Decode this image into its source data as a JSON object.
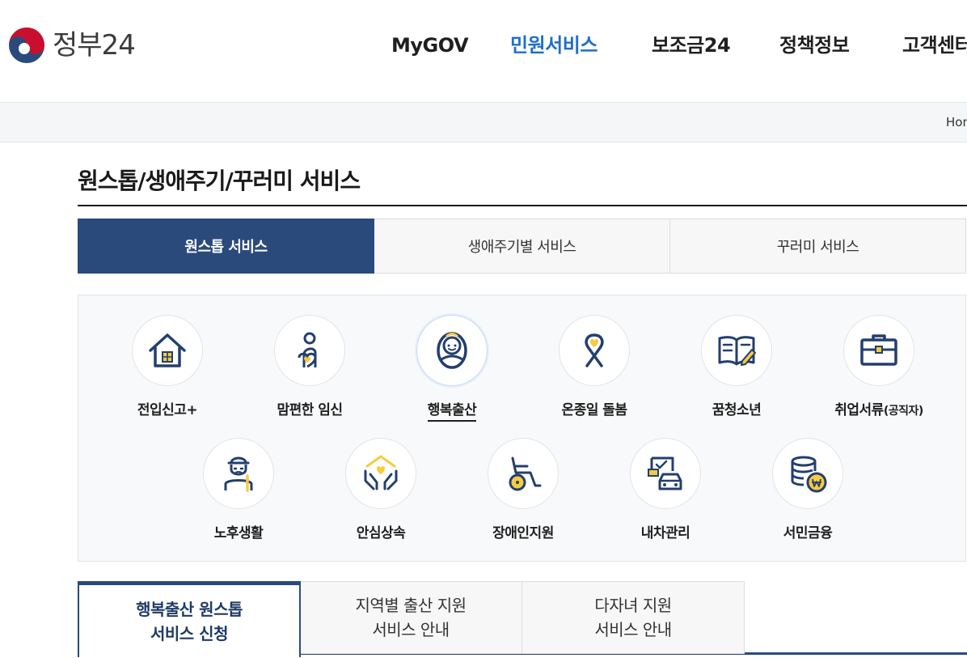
{
  "header": {
    "logo_text": "정부24",
    "nav": [
      {
        "label": "MyGOV",
        "active": false
      },
      {
        "label": "민원서비스",
        "active": true
      },
      {
        "label": "보조금24",
        "active": false
      },
      {
        "label": "정책정보",
        "active": false
      },
      {
        "label": "고객센터",
        "active": false
      }
    ]
  },
  "breadcrumb": {
    "home": "Home"
  },
  "page": {
    "title": "원스톱/생애주기/꾸러미 서비스"
  },
  "tabs": [
    {
      "label": "원스톱 서비스",
      "active": true
    },
    {
      "label": "생애주기별 서비스",
      "active": false
    },
    {
      "label": "꾸러미 서비스",
      "active": false
    }
  ],
  "services": [
    {
      "label": "전입신고+",
      "icon": "house-icon"
    },
    {
      "label": "맘편한 임신",
      "icon": "pregnancy-icon"
    },
    {
      "label": "행복출산",
      "icon": "baby-icon",
      "active": true
    },
    {
      "label": "온종일 돌봄",
      "icon": "ribbon-heart-icon"
    },
    {
      "label": "꿈청소년",
      "icon": "book-pencil-icon"
    },
    {
      "label": "취업서류",
      "suffix": "(공직자)",
      "icon": "briefcase-icon"
    },
    {
      "label": "노후생활",
      "icon": "elderly-icon"
    },
    {
      "label": "안심상속",
      "icon": "hands-heart-icon"
    },
    {
      "label": "장애인지원",
      "icon": "wheelchair-icon"
    },
    {
      "label": "내차관리",
      "icon": "car-document-icon"
    },
    {
      "label": "서민금융",
      "icon": "coins-icon"
    }
  ],
  "subtabs": [
    {
      "line1": "행복출산 원스톱",
      "line2": "서비스 신청",
      "active": true
    },
    {
      "line1": "지역별 출산 지원",
      "line2": "서비스 안내",
      "active": false
    },
    {
      "line1": "다자녀 지원",
      "line2": "서비스 안내",
      "active": false
    }
  ],
  "colors": {
    "navy": "#2b4a7c",
    "accent_blue": "#1f6fc9",
    "icon_stroke": "#233f6e",
    "icon_yellow": "#f6cb3f"
  }
}
